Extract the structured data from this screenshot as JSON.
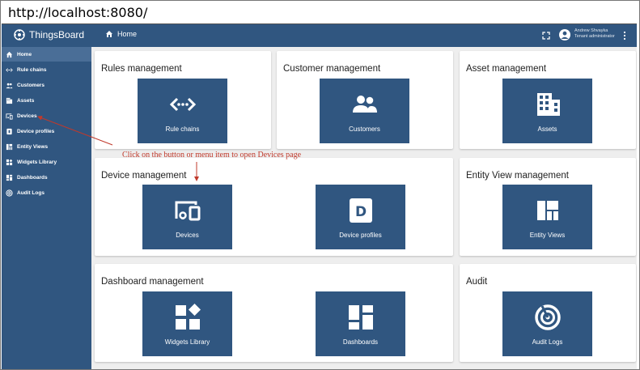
{
  "browser": {
    "url": "http://localhost:8080/"
  },
  "topbar": {
    "app_name": "ThingsBoard",
    "breadcrumb": "Home",
    "user_name": "Andrew Shvayka",
    "user_role": "Tenant administrator"
  },
  "sidebar": {
    "items": [
      {
        "label": "Home",
        "icon": "home-icon"
      },
      {
        "label": "Rule chains",
        "icon": "rule-chain-icon"
      },
      {
        "label": "Customers",
        "icon": "customers-icon"
      },
      {
        "label": "Assets",
        "icon": "assets-icon"
      },
      {
        "label": "Devices",
        "icon": "devices-icon"
      },
      {
        "label": "Device profiles",
        "icon": "device-profile-icon"
      },
      {
        "label": "Entity Views",
        "icon": "entity-views-icon"
      },
      {
        "label": "Widgets Library",
        "icon": "widgets-icon"
      },
      {
        "label": "Dashboards",
        "icon": "dashboards-icon"
      },
      {
        "label": "Audit Logs",
        "icon": "audit-logs-icon"
      }
    ]
  },
  "cards": {
    "rules": {
      "title": "Rules management",
      "tiles": [
        {
          "label": "Rule chains"
        }
      ]
    },
    "customers": {
      "title": "Customer management",
      "tiles": [
        {
          "label": "Customers"
        }
      ]
    },
    "assets": {
      "title": "Asset management",
      "tiles": [
        {
          "label": "Assets"
        }
      ]
    },
    "devices": {
      "title": "Device management",
      "tiles": [
        {
          "label": "Devices"
        },
        {
          "label": "Device profiles"
        }
      ]
    },
    "entity_views": {
      "title": "Entity View management",
      "tiles": [
        {
          "label": "Entity Views"
        }
      ]
    },
    "dashboards": {
      "title": "Dashboard management",
      "tiles": [
        {
          "label": "Widgets Library"
        },
        {
          "label": "Dashboards"
        }
      ]
    },
    "audit": {
      "title": "Audit",
      "tiles": [
        {
          "label": "Audit Logs"
        }
      ]
    }
  },
  "annotation": {
    "text": "Click on the button or menu item to open Devices page"
  },
  "colors": {
    "primary": "#305680",
    "annotation": "#c0392b",
    "background": "#eeeeee"
  }
}
